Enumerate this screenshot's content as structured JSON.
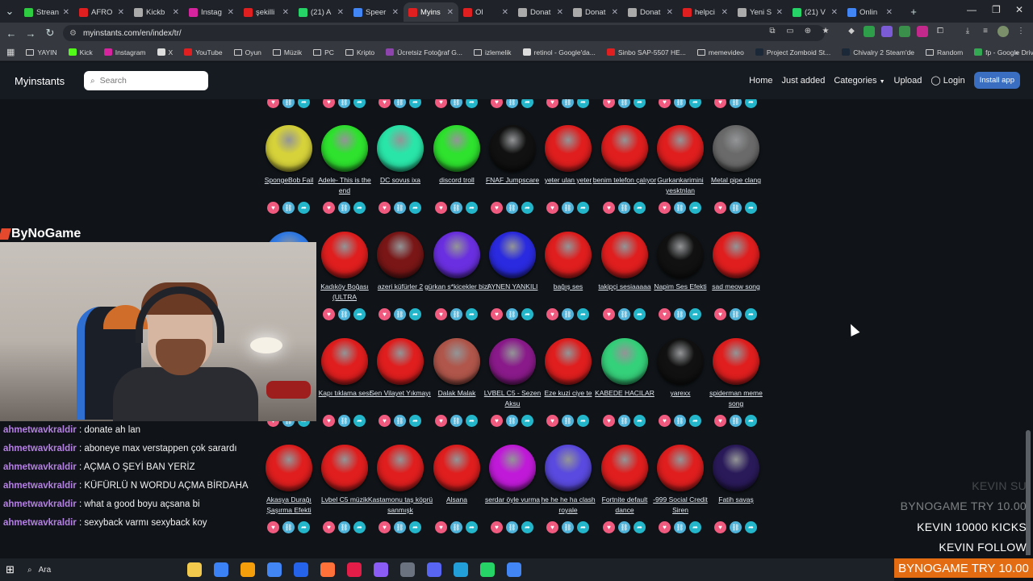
{
  "browser": {
    "tabs": [
      {
        "label": "Strean",
        "color": "#2ecc40"
      },
      {
        "label": "AFRO",
        "color": "#e02020"
      },
      {
        "label": "Kickb",
        "color": "#aaaaaa"
      },
      {
        "label": "Instag",
        "color": "#d6249f"
      },
      {
        "label": "şekilli",
        "color": "#e02020"
      },
      {
        "label": "(21) A",
        "color": "#25d366"
      },
      {
        "label": "Speer",
        "color": "#4285f4"
      },
      {
        "label": "Myins",
        "color": "#e02020",
        "active": true
      },
      {
        "label": "Ol",
        "color": "#e02020"
      },
      {
        "label": "Donat",
        "color": "#aaaaaa"
      },
      {
        "label": "Donat",
        "color": "#aaaaaa"
      },
      {
        "label": "Donat",
        "color": "#aaaaaa"
      },
      {
        "label": "helpci",
        "color": "#e02020"
      },
      {
        "label": "Yeni S",
        "color": "#aaaaaa"
      },
      {
        "label": "(21) V",
        "color": "#25d366"
      },
      {
        "label": "Onlin",
        "color": "#4285f4"
      }
    ],
    "url": "myinstants.com/en/index/tr/",
    "bookmarks": [
      {
        "label": "YAYIN",
        "type": "folder"
      },
      {
        "label": "Kick",
        "type": "icon",
        "color": "#53fc18"
      },
      {
        "label": "Instagram",
        "type": "icon",
        "color": "#d6249f"
      },
      {
        "label": "X",
        "type": "icon",
        "color": "#dddddd"
      },
      {
        "label": "YouTube",
        "type": "icon",
        "color": "#e02020"
      },
      {
        "label": "Oyun",
        "type": "folder"
      },
      {
        "label": "Müzik",
        "type": "folder"
      },
      {
        "label": "PC",
        "type": "folder"
      },
      {
        "label": "Kripto",
        "type": "folder"
      },
      {
        "label": "Ücretsiz Fotoğraf G...",
        "type": "icon",
        "color": "#8e44ad"
      },
      {
        "label": "izlemelik",
        "type": "folder"
      },
      {
        "label": "retinol - Google'da...",
        "type": "icon",
        "color": "#dddddd"
      },
      {
        "label": "Sinbo SAP-5507 HE...",
        "type": "icon",
        "color": "#e02020"
      },
      {
        "label": "memevideo",
        "type": "folder"
      },
      {
        "label": "Project Zomboid St...",
        "type": "icon",
        "color": "#1b2838"
      },
      {
        "label": "Chivalry 2 Steam'de",
        "type": "icon",
        "color": "#1b2838"
      },
      {
        "label": "Random",
        "type": "folder"
      },
      {
        "label": "fp - Google Drive",
        "type": "icon",
        "color": "#34a853"
      }
    ]
  },
  "site": {
    "logo": "Myinstants",
    "search_placeholder": "Search",
    "nav": {
      "home": "Home",
      "just_added": "Just added",
      "categories": "Categories",
      "upload": "Upload",
      "login": "Login",
      "install": "Install app"
    }
  },
  "buttons_rows": [
    [
      {
        "label": "SpongeBob Fail",
        "color": "#d6d23a"
      },
      {
        "label": "Adele- This is the end",
        "color": "#2ee22e"
      },
      {
        "label": "DC sovus ixa",
        "color": "#29e6a8"
      },
      {
        "label": "discord troll",
        "color": "#2ee22e"
      },
      {
        "label": "FNAF Jumpscare",
        "color": "#111111"
      },
      {
        "label": "yeter ulan yeter",
        "color": "#e01e1e"
      },
      {
        "label": "benim telefon çalıyor",
        "color": "#e01e1e"
      },
      {
        "label": "Gurkankarimini yesktnlan",
        "color": "#e01e1e"
      },
      {
        "label": "Metal pipe clang",
        "color": "#6a6a6a"
      }
    ],
    [
      {
        "label": "",
        "color": "#2f7ae5"
      },
      {
        "label": "Kadıköy Boğası (ULTRA",
        "color": "#e01e1e"
      },
      {
        "label": "azeri küfürler 2",
        "color": "#7a1616"
      },
      {
        "label": "gürkan s*kicekler bizi",
        "color": "#6a2fe0"
      },
      {
        "label": "AYNEN YANKILI",
        "color": "#2a2ae0"
      },
      {
        "label": "bağış ses",
        "color": "#e01e1e"
      },
      {
        "label": "takipçi sesiaaaaa",
        "color": "#e01e1e"
      },
      {
        "label": "Napim Ses Efekti",
        "color": "#111111"
      },
      {
        "label": "sad meow song",
        "color": "#e01e1e"
      }
    ],
    [
      {
        "label": "",
        "color": "#e01e1e"
      },
      {
        "label": "Kapı tıklama sesi",
        "color": "#e01e1e"
      },
      {
        "label": "Sen Vilayet Yıkmayı",
        "color": "#e01e1e"
      },
      {
        "label": "Dalak Malak",
        "color": "#b0564a"
      },
      {
        "label": "LVBEL C5 - Sezen Aksu",
        "color": "#8a1a8a"
      },
      {
        "label": "Eze kuzi ciye te",
        "color": "#e01e1e"
      },
      {
        "label": "KABEDE HACILAR",
        "color": "#35d07a"
      },
      {
        "label": "yarexx",
        "color": "#111111"
      },
      {
        "label": "spiderman meme song",
        "color": "#e01e1e"
      }
    ],
    [
      {
        "label": "Akasya Durağı Şaşırma Efekti",
        "color": "#e01e1e"
      },
      {
        "label": "Lvbel C5 müzik",
        "color": "#e01e1e"
      },
      {
        "label": "Kastamonu taş köprü sanmışk",
        "color": "#e01e1e"
      },
      {
        "label": "Alsana",
        "color": "#e01e1e"
      },
      {
        "label": "serdar öyle vurma",
        "color": "#c01ad8"
      },
      {
        "label": "he he he ha clash royale",
        "color": "#5a4adf"
      },
      {
        "label": "Fortnite default dance",
        "color": "#e01e1e"
      },
      {
        "label": "-999 Social Credit Siren",
        "color": "#e01e1e"
      },
      {
        "label": "Fatih savaş",
        "color": "#2a1a5a"
      }
    ]
  ],
  "stream": {
    "brand": "ByNoGame",
    "chat": [
      {
        "user": "ahmetwavkraldir",
        "message": "donate ah lan"
      },
      {
        "user": "ahmetwavkraldir",
        "message": "aboneye max verstappen çok sarardı"
      },
      {
        "user": "ahmetwavkraldir",
        "message": "AÇMA O ŞEYİ BAN YERİZ"
      },
      {
        "user": "ahmetwavkraldir",
        "message": "KÜFÜRLÜ N WORDU AÇMA BİRDAHA"
      },
      {
        "user": "ahmetwavkraldir",
        "message": "what a good boyu açsana bi"
      },
      {
        "user": "ahmetwavkraldir",
        "message": "sexyback varmı sexyback koy"
      }
    ],
    "alerts": [
      {
        "text": "KEVIN  SU",
        "style": "faded"
      },
      {
        "text": "BYNOGAME  TRY 10.00",
        "style": "faded2"
      },
      {
        "text": "KEVIN  10000 KICKS",
        "style": "solid"
      },
      {
        "text": "KEVIN  FOLLOW",
        "style": "solid"
      }
    ],
    "alert_bar": "BYNOGAME  TRY 10.00"
  },
  "taskbar": {
    "search_label": "Ara",
    "apps": [
      "#f2c94c",
      "#3b82f6",
      "#f59e0b",
      "#4285f4",
      "#2563eb",
      "#ff7139",
      "#e11d48",
      "#8b5cf6",
      "#6b7280",
      "#5865f2",
      "#229ed9",
      "#25d366",
      "#4285f4"
    ]
  }
}
